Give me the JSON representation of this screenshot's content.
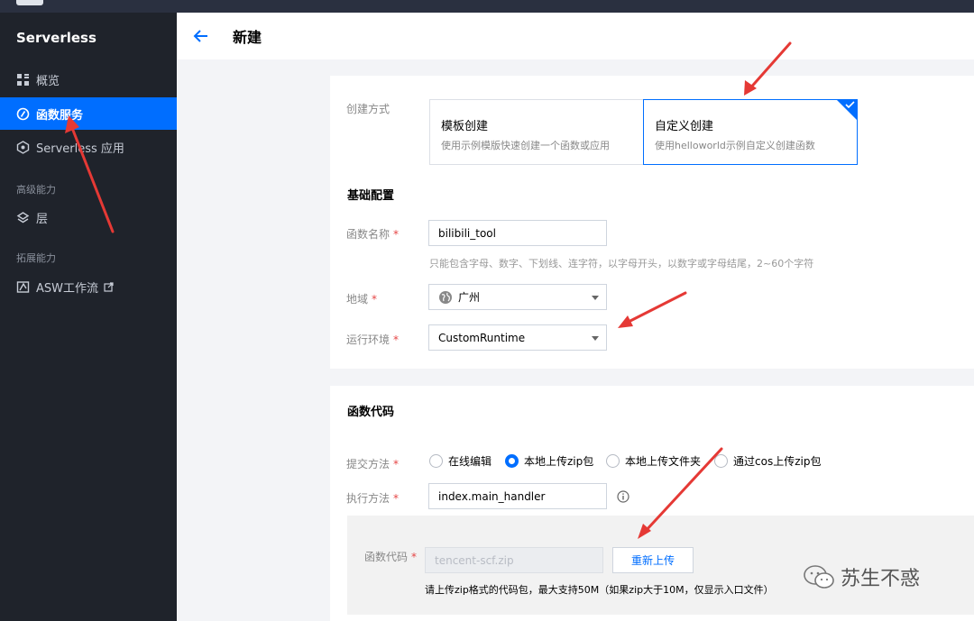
{
  "sidebar": {
    "title": "Serverless",
    "items": [
      {
        "label": "概览",
        "icon": "grid-icon"
      },
      {
        "label": "函数服务",
        "icon": "function-icon",
        "active": true
      },
      {
        "label": "Serverless 应用",
        "icon": "app-icon"
      }
    ],
    "group_advanced": "高级能力",
    "layer_label": "层",
    "group_extend": "拓展能力",
    "asw_label": "ASW工作流"
  },
  "header": {
    "title": "新建"
  },
  "create_method": {
    "label": "创建方式",
    "options": [
      {
        "title": "模板创建",
        "desc": "使用示例模版快速创建一个函数或应用"
      },
      {
        "title": "自定义创建",
        "desc": "使用helloworld示例自定义创建函数",
        "selected": true
      }
    ]
  },
  "basic": {
    "title": "基础配置",
    "name_label": "函数名称",
    "name_value": "bilibili_tool",
    "name_hint": "只能包含字母、数字、下划线、连字符，以字母开头，以数字或字母结尾，2~60个字符",
    "region_label": "地域",
    "region_value": "广州",
    "runtime_label": "运行环境",
    "runtime_value": "CustomRuntime"
  },
  "code": {
    "title": "函数代码",
    "submit_label": "提交方法",
    "submit_options": [
      "在线编辑",
      "本地上传zip包",
      "本地上传文件夹",
      "通过cos上传zip包"
    ],
    "submit_selected": 1,
    "handler_label": "执行方法",
    "handler_value": "index.main_handler",
    "package_label": "函数代码",
    "package_value": "tencent-scf.zip",
    "reupload_label": "重新上传",
    "upload_tip": "请上传zip格式的代码包，最大支持50M（如果zip大于10M，仅显示入口文件）"
  },
  "watermark": {
    "text": "苏生不惑"
  },
  "colors": {
    "accent": "#006eff",
    "sidebar_bg": "#1f232b",
    "annotation": "#e53935"
  }
}
